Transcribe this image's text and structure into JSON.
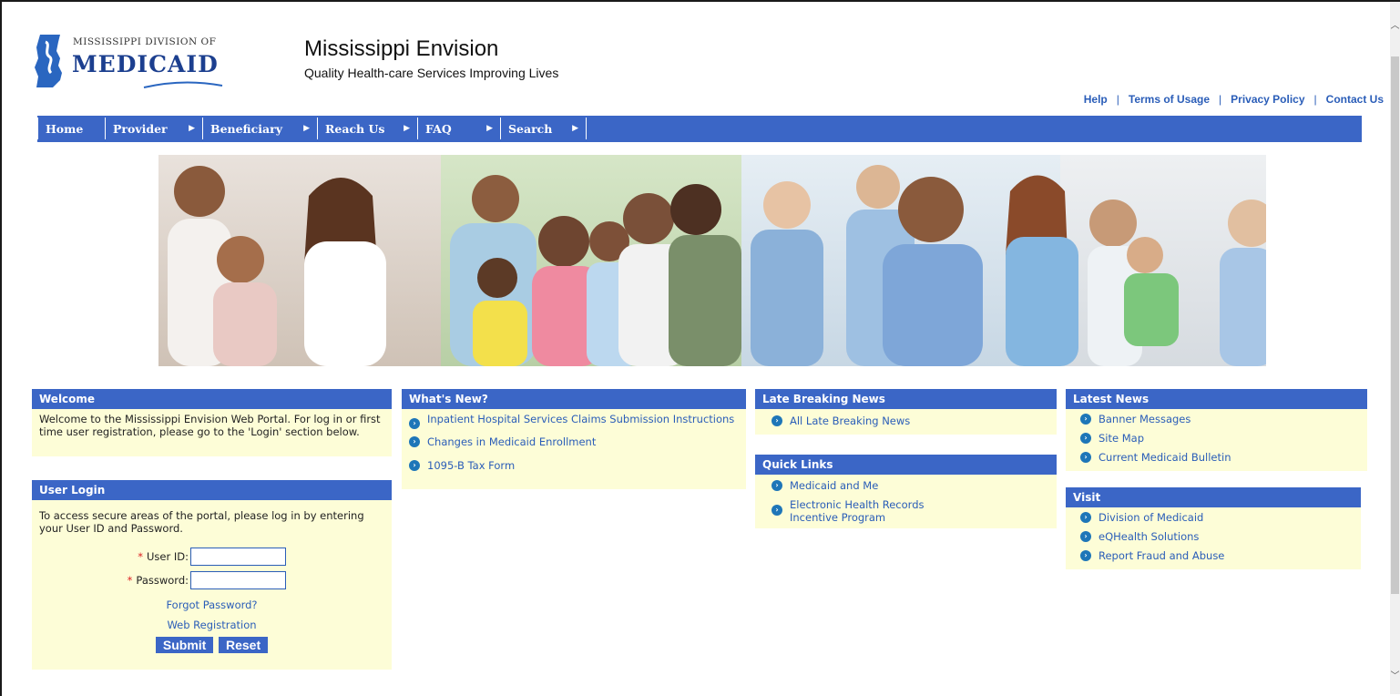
{
  "header": {
    "logo_small": "MISSISSIPPI DIVISION OF",
    "logo_big": "MEDICAID",
    "title": "Mississippi Envision",
    "tagline": "Quality Health-care Services Improving Lives"
  },
  "toplinks": {
    "help": "Help",
    "terms": "Terms of Usage",
    "privacy": "Privacy Policy",
    "contact": "Contact Us",
    "separator": "|"
  },
  "nav": {
    "home": "Home",
    "provider": "Provider",
    "beneficiary": "Beneficiary",
    "reach_us": "Reach Us",
    "faq": "FAQ",
    "search": "Search",
    "arrow": "▶"
  },
  "welcome": {
    "title": "Welcome",
    "text": "Welcome to the Mississippi Envision Web Portal. For log in or first time user registration, please go to the 'Login' section below."
  },
  "login": {
    "title": "User Login",
    "intro": "To access secure areas of the portal, please log in by entering your User ID and Password.",
    "required_mark": "*",
    "userid_label": "User ID:",
    "password_label": "Password:",
    "userid_value": "",
    "password_value": "",
    "forgot": "Forgot Password?",
    "register": "Web Registration",
    "submit": "Submit",
    "reset": "Reset"
  },
  "whats_new": {
    "title": "What's New?",
    "items": [
      "Inpatient Hospital Services Claims Submission Instructions",
      "Changes in Medicaid Enrollment",
      "1095-B Tax Form"
    ]
  },
  "late_news": {
    "title": "Late Breaking News",
    "items": [
      "All Late Breaking News"
    ]
  },
  "quick_links": {
    "title": "Quick Links",
    "items": [
      "Medicaid and Me",
      "Electronic Health Records Incentive Program"
    ]
  },
  "latest_news": {
    "title": "Latest News",
    "items": [
      "Banner Messages",
      "Site Map",
      "Current Medicaid Bulletin"
    ]
  },
  "visit": {
    "title": "Visit",
    "items": [
      "Division of Medicaid",
      "eQHealth Solutions",
      "Report Fraud and Abuse"
    ]
  },
  "icons": {
    "bullet": "bullet-arrow-icon",
    "logo": "mississippi-state-logo-icon"
  },
  "colors": {
    "nav_blue": "#3b66c6",
    "link_blue": "#2a5db8",
    "panel_bg": "#fdfdd7",
    "logo_blue": "#1c3f8f"
  }
}
